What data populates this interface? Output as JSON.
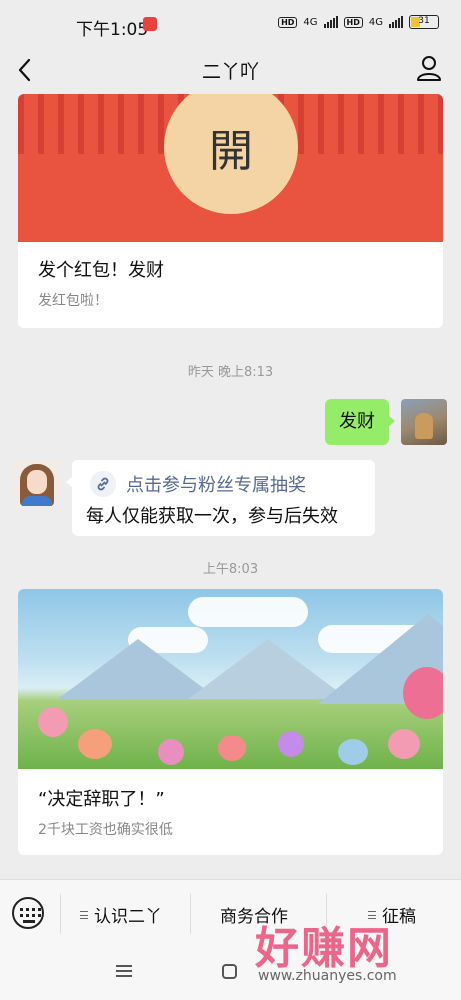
{
  "status_bar": {
    "time": "下午1:05",
    "network": "4G",
    "battery": "31"
  },
  "nav": {
    "title": "二丫吖"
  },
  "messages": {
    "red_packet": {
      "seal_char": "開",
      "title": "发个红包！发财",
      "subtitle": "发红包啦！"
    },
    "timestamp_1": "昨天 晚上8:13",
    "outgoing_text": "发财",
    "incoming": {
      "link_text": "点击参与粉丝专属抽奖",
      "note": "每人仅能获取一次，参与后失效"
    },
    "timestamp_2": "上午8:03",
    "article": {
      "title": "“决定辞职了！”",
      "subtitle": "2千块工资也确实很低"
    }
  },
  "menu": {
    "item1": "认识二丫",
    "item2": "商务合作",
    "item3": "征稿"
  },
  "watermark": {
    "brand": "好赚网",
    "url": "www.zhuanyes.com"
  },
  "colors": {
    "background": "#ededed",
    "bubble_out": "#95ec69",
    "link": "#576b95",
    "red_packet": "#e8543f"
  }
}
